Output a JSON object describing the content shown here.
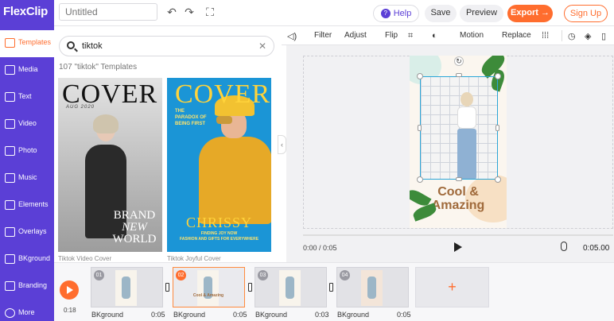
{
  "app": {
    "logo": "FlexClip"
  },
  "header": {
    "title_placeholder": "Untitled",
    "help_label": "Help",
    "save_label": "Save",
    "preview_label": "Preview",
    "export_label": "Export →",
    "signup_label": "Sign Up"
  },
  "sidebar": {
    "items": [
      {
        "label": "Templates",
        "icon": "templates-icon"
      },
      {
        "label": "Media",
        "icon": "media-icon"
      },
      {
        "label": "Text",
        "icon": "text-icon"
      },
      {
        "label": "Video",
        "icon": "video-icon"
      },
      {
        "label": "Photo",
        "icon": "photo-icon"
      },
      {
        "label": "Music",
        "icon": "music-icon"
      },
      {
        "label": "Elements",
        "icon": "elements-icon"
      },
      {
        "label": "Overlays",
        "icon": "overlays-icon"
      },
      {
        "label": "BKground",
        "icon": "background-icon"
      },
      {
        "label": "Branding",
        "icon": "branding-icon"
      },
      {
        "label": "More",
        "icon": "more-icon"
      }
    ]
  },
  "templates": {
    "search_value": "tiktok",
    "count_label": "107 \"tiktok\" Templates",
    "cards": [
      {
        "caption": "Tiktok Video Cover",
        "cover_word": "COVER",
        "date_text": "AUG 2020",
        "headline": [
          "BRAND",
          "NEW",
          "WORLD"
        ]
      },
      {
        "caption": "Tiktok Joyful Cover",
        "cover_word": "COVER",
        "paradox_text": "THE PARADOX OF BEING FIRST",
        "name": "CHRISSY",
        "sub_line1": "FINDING JOY NOW",
        "sub_line2": "FASHION AND GIFTS FOR EVERYWHERE"
      }
    ]
  },
  "edit_toolbar": {
    "filter_label": "Filter",
    "adjust_label": "Adjust",
    "flip_label": "Flip",
    "motion_label": "Motion",
    "replace_label": "Replace"
  },
  "canvas": {
    "headline_line1": "Cool &",
    "headline_line2": "Amazing"
  },
  "playback": {
    "current_time": "0:00 / 0:05",
    "total_time": "0:05.00"
  },
  "timeline": {
    "position": "0:18",
    "clips": [
      {
        "number": "01",
        "label": "BKground",
        "duration": "0:05",
        "selected": false
      },
      {
        "number": "02",
        "label": "BKground",
        "duration": "0:05",
        "selected": true,
        "thumb_text": "Cool & Amazing"
      },
      {
        "number": "03",
        "label": "BKground",
        "duration": "0:03",
        "selected": false
      },
      {
        "number": "04",
        "label": "BKground",
        "duration": "0:05",
        "selected": false
      }
    ],
    "add_label": "+"
  },
  "colors": {
    "brand_purple": "#5b3fd6",
    "accent_orange": "#ff6d2e",
    "selection_blue": "#2aa6d8"
  }
}
